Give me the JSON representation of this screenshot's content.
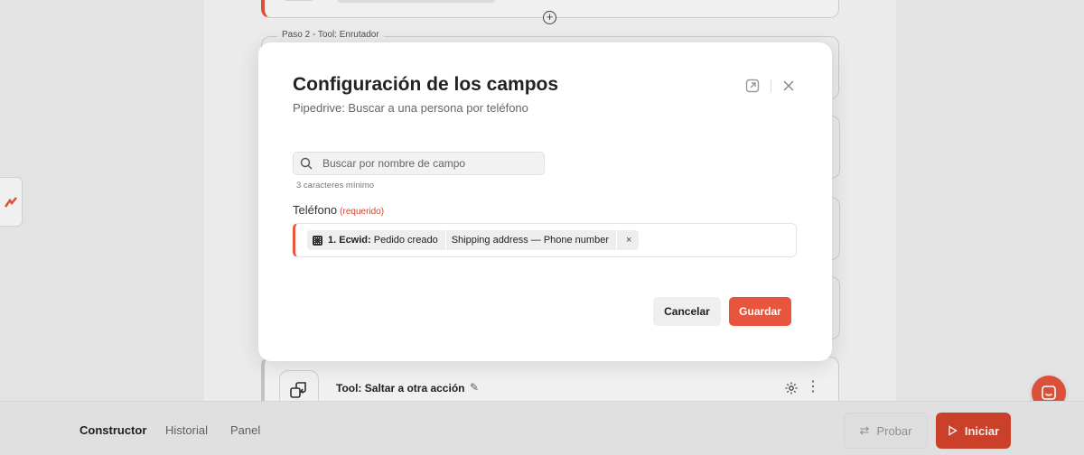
{
  "canvas": {
    "step2_label": "Paso 2 - Tool: Enrutador",
    "tool_card_title": "Tool: Saltar a otra acción",
    "add_step_symbol": "+"
  },
  "bottom_nav": {
    "tabs": [
      {
        "label": "Constructor",
        "active": true
      },
      {
        "label": "Historial",
        "active": false
      },
      {
        "label": "Panel",
        "active": false
      }
    ],
    "test_button": "Probar",
    "start_button": "Iniciar"
  },
  "modal": {
    "title": "Configuración de los campos",
    "subtitle": "Pipedrive: Buscar a una persona por teléfono",
    "search": {
      "placeholder": "Buscar por nombre de campo",
      "value": "",
      "hint": "3 caracteres mínimo"
    },
    "field": {
      "label": "Teléfono",
      "required_text": "(requerido)",
      "chip": {
        "step": "1. Ecwid:",
        "event": "Pedido creado",
        "path": "Shipping address — Phone number",
        "remove_symbol": "×"
      }
    },
    "cancel_button": "Cancelar",
    "save_button": "Guardar"
  },
  "colors": {
    "accent": "#e8553d",
    "accent_dark": "#d8442c"
  }
}
